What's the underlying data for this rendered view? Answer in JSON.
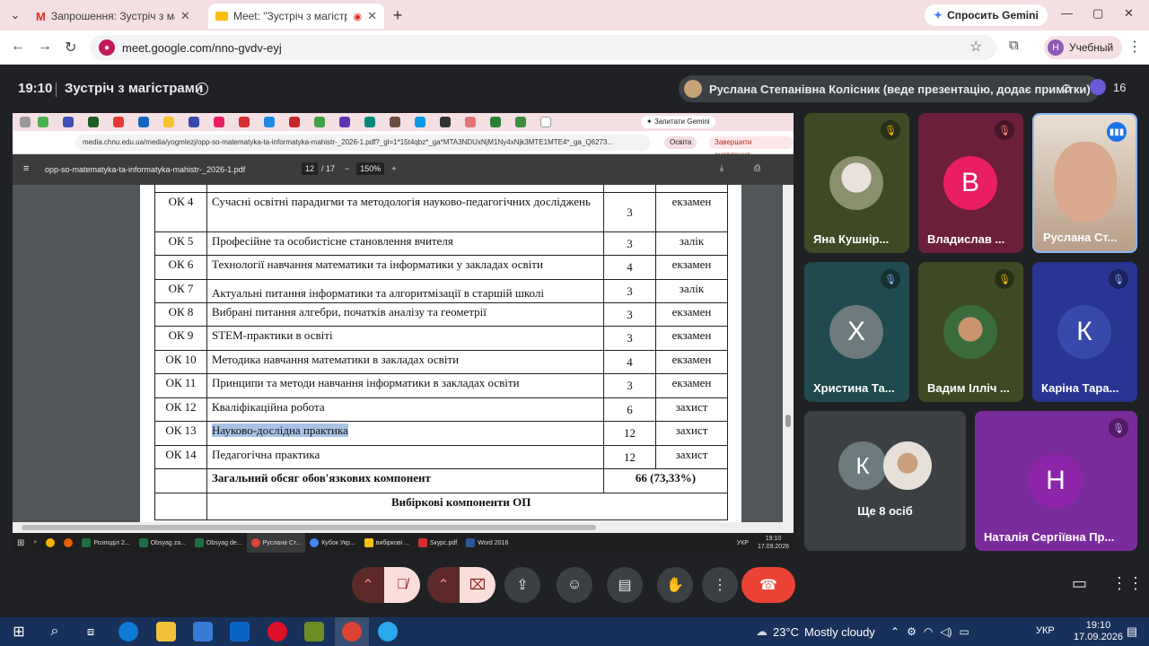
{
  "browser": {
    "tabs": [
      {
        "title": "Запрошення: Зустріч з магістр",
        "active": false
      },
      {
        "title": "Meet: \"Зустріч з магістрам",
        "active": true
      }
    ],
    "gemini_label": "Спросить Gemini",
    "url": "meet.google.com/nno-gvdv-eyj",
    "profile_label": "Учебный",
    "profile_initial": "Н"
  },
  "meet": {
    "time": "19:10",
    "title": "Зустріч з магістрами",
    "presenter": "Руслана Степанівна Колісник (веде презентацію, додає примітки)",
    "participant_count": "16"
  },
  "shared": {
    "gemini_label": "Запитати Gemini",
    "url": "media.chnu.edu.ua/media/yogmlezj/opp-so-matematyka-ta-informatyka-mahistr-_2026-1.pdf?_gl=1*15t4qbz*_ga*MTA3NDUxNjM1Ny4xNjk3MTE1MTE4*_ga_Q6273...",
    "chip_osvita": "Освіта",
    "chip_update": "Завершити оновлення",
    "pdf_name": "opp-so-matematyka-ta-informatyka-mahistr-_2026-1.pdf",
    "page_current": "12",
    "page_total": "/ 17",
    "zoom": "150%",
    "rows": [
      {
        "code": "ОК 4",
        "name": "Сучасні освітні парадигми та методологія науково-педагогічних досліджень",
        "credits": "3",
        "form": "екзамен"
      },
      {
        "code": "ОК 5",
        "name": "Професійне та особистісне становлення вчителя",
        "credits": "3",
        "form": "залік"
      },
      {
        "code": "ОК 6",
        "name": "Технології навчання математики та інформатики у закладах освіти",
        "credits": "4",
        "form": "екзамен"
      },
      {
        "code": "ОК 7",
        "name": "Актуальні питання інформатики та алгоритмізації в старшій школі",
        "credits": "3",
        "form": "залік"
      },
      {
        "code": "ОК 8",
        "name": "Вибрані питання алгебри, початків аналізу та геометрії",
        "credits": "3",
        "form": "екзамен"
      },
      {
        "code": "ОК 9",
        "name": "STEM-практики в освіті",
        "credits": "3",
        "form": "екзамен"
      },
      {
        "code": "ОК 10",
        "name": "Методика навчання математики в закладах освіти",
        "credits": "4",
        "form": "екзамен"
      },
      {
        "code": "ОК 11",
        "name": "Принципи та методи навчання інформатики в закладах освіти",
        "credits": "3",
        "form": "екзамен"
      },
      {
        "code": "ОК 12",
        "name": "Кваліфікаційна робота",
        "credits": "6",
        "form": "захист"
      },
      {
        "code": "ОК 13",
        "name": "Науково-дослідна практика",
        "credits": "12",
        "form": "захист"
      },
      {
        "code": "ОК 14",
        "name": "Педагогічна практика",
        "credits": "12",
        "form": "захист"
      }
    ],
    "total_label": "Загальний обсяг обов'язкових компонент",
    "total_value": "66 (73,33%)",
    "elective_header": "Вибіркові компоненти  ОП",
    "inner_taskbar": [
      "Розподіл 2...",
      "Obsyag za...",
      "Obsyag de...",
      "Руслана Ст...",
      "Кубок Укр...",
      "вибіркові ...",
      "Sкурс.pdf",
      "Word 2016"
    ],
    "inner_lang": "УКР",
    "inner_time": "19:10",
    "inner_date": "17.09.2026"
  },
  "participants": [
    {
      "name": "Яна Кушнір...",
      "initial": "",
      "color": "#3d4a24"
    },
    {
      "name": "Владислав ...",
      "initial": "В",
      "color": "#e91e63"
    },
    {
      "name": "Руслана Ст...",
      "initial": "",
      "color": "#6a5a48"
    },
    {
      "name": "Христина Та...",
      "initial": "Х",
      "color": "#6d7b7e"
    },
    {
      "name": "Вадим Ілліч ...",
      "initial": "",
      "color": "#3d4a24"
    },
    {
      "name": "Каріна Тара...",
      "initial": "К",
      "color": "#3949ab"
    },
    {
      "name": "Ще 8 осіб",
      "initial": "К",
      "color": "#6d7b7e"
    },
    {
      "name": "Наталія Сергіївна Пр...",
      "initial": "Н",
      "color": "#8e24aa"
    }
  ],
  "taskbar": {
    "weather_temp": "23°C",
    "weather_text": "Mostly cloudy",
    "lang": "УКР",
    "time": "19:10",
    "date": "17.09.2026"
  },
  "colors": {
    "meet_bg": "#202124",
    "end_call": "#ea4335",
    "mute_active": "#f9dedc",
    "tab_strip": "#f4dfe3"
  }
}
